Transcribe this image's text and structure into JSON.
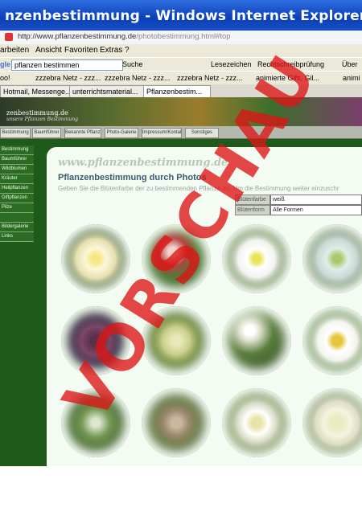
{
  "window": {
    "title": "nzenbestimmung - Windows Internet Explorer",
    "url_domain": "http://www.pflanzenbestimmung.de",
    "url_path": "/photobestimmung.html#top"
  },
  "menu": [
    "arbeiten",
    "Ansicht",
    "Favoriten",
    "Extras",
    "?"
  ],
  "toolbar1": {
    "search_text": "pflanzen bestimmen",
    "suche_label": "Suche",
    "lesezeichen_label": "Lesezeichen",
    "rechtschreib_label": "Rechtschreibprüfung",
    "uber_label": "Über"
  },
  "toolbar2": {
    "item0": "oo!",
    "links": [
      "zzzebra Netz - zzz...",
      "zzzebra Netz - zzz...",
      "zzzebra Netz - zzz..."
    ],
    "check1": "animierte Gifs, Gil...",
    "check2": "animi"
  },
  "tabs": [
    "Hotmail, Messenge...",
    "unterrichtsmaterial...",
    "Pflanzenbestim..."
  ],
  "site": {
    "logo_text": "zenbestimmung.de",
    "logo_sub": "unsere Pflanzen Bestimmung",
    "nav": [
      "Bestimmung",
      "Baumführer",
      "Bekannte Pflanzen",
      "Photo-Galerie",
      "Impressum/Kontakt",
      "Sonstiges"
    ],
    "sidebar": [
      "Bestimmung",
      "Baumführer",
      "Wildblumen",
      "Kräuter",
      "Heilpflanzen",
      "Giftpflanzen",
      "Pilze",
      "",
      "Bildergalerie",
      "Links"
    ],
    "panel_title": "www.pflanzenbestimmung.de",
    "panel_heading": "Pflanzenbestimmung durch Photos",
    "panel_desc": "Geben Sie die Blütenfarbe der zu bestimmenden Pflanze an. Um die Bestimmung weiter einzuschr",
    "filter1_label": "Blütenfarbe",
    "filter1_value": "weiß",
    "filter2_label": "Blütenform",
    "filter2_value": "Alle Formen"
  },
  "watermark": "VORSCHAU",
  "colors": {
    "title_bar": "#0a3fb8",
    "page_green": "#1e5a1a",
    "panel_bg": "#f4fbf2",
    "watermark": "#dc1414"
  }
}
